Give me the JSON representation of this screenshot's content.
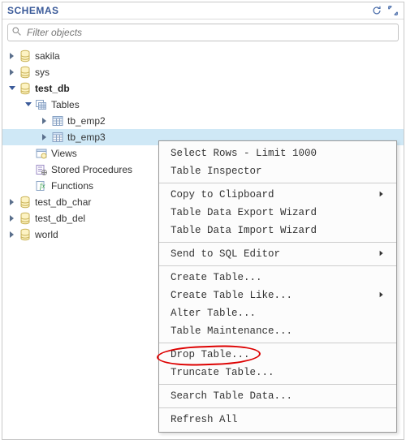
{
  "header": {
    "title": "SCHEMAS"
  },
  "search": {
    "placeholder": "Filter objects"
  },
  "tree": {
    "items": [
      {
        "label": "sakila",
        "icon": "db",
        "depth": 0,
        "expanded": false,
        "arrow": true
      },
      {
        "label": "sys",
        "icon": "db",
        "depth": 0,
        "expanded": false,
        "arrow": true
      },
      {
        "label": "test_db",
        "icon": "db",
        "depth": 0,
        "expanded": true,
        "arrow": true,
        "bold": true
      },
      {
        "label": "Tables",
        "icon": "tables",
        "depth": 1,
        "expanded": true,
        "arrow": true
      },
      {
        "label": "tb_emp2",
        "icon": "table",
        "depth": 2,
        "expanded": false,
        "arrow": true
      },
      {
        "label": "tb_emp3",
        "icon": "table",
        "depth": 2,
        "expanded": false,
        "arrow": true,
        "selected": true
      },
      {
        "label": "Views",
        "icon": "view",
        "depth": 1,
        "expanded": false,
        "arrow": false
      },
      {
        "label": "Stored Procedures",
        "icon": "proc",
        "depth": 1,
        "expanded": false,
        "arrow": false
      },
      {
        "label": "Functions",
        "icon": "func",
        "depth": 1,
        "expanded": false,
        "arrow": false
      },
      {
        "label": "test_db_char",
        "icon": "db",
        "depth": 0,
        "expanded": false,
        "arrow": true
      },
      {
        "label": "test_db_del",
        "icon": "db",
        "depth": 0,
        "expanded": false,
        "arrow": true
      },
      {
        "label": "world",
        "icon": "db",
        "depth": 0,
        "expanded": false,
        "arrow": true
      }
    ]
  },
  "context_menu": {
    "items": [
      {
        "label": "Select Rows - Limit 1000"
      },
      {
        "label": "Table Inspector"
      },
      {
        "sep": true
      },
      {
        "label": "Copy to Clipboard",
        "submenu": true
      },
      {
        "label": "Table Data Export Wizard"
      },
      {
        "label": "Table Data Import Wizard"
      },
      {
        "sep": true
      },
      {
        "label": "Send to SQL Editor",
        "submenu": true
      },
      {
        "sep": true
      },
      {
        "label": "Create Table..."
      },
      {
        "label": "Create Table Like...",
        "submenu": true
      },
      {
        "label": "Alter Table..."
      },
      {
        "label": "Table Maintenance..."
      },
      {
        "sep": true
      },
      {
        "label": "Drop Table..."
      },
      {
        "label": "Truncate Table..."
      },
      {
        "sep": true
      },
      {
        "label": "Search Table Data..."
      },
      {
        "sep": true
      },
      {
        "label": "Refresh All"
      }
    ]
  }
}
